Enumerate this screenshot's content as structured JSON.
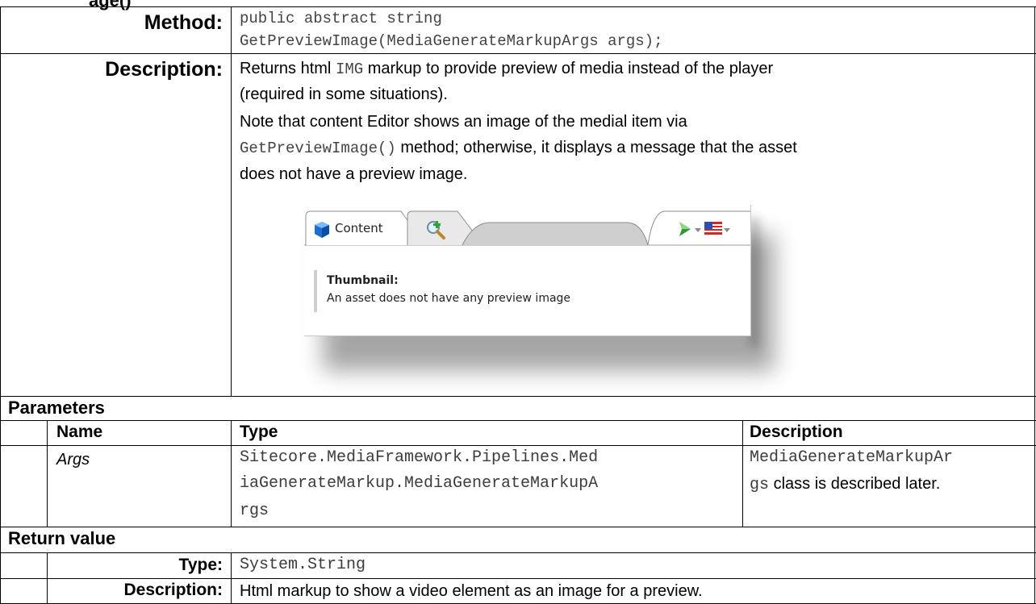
{
  "heading_fragment": "age()",
  "method": {
    "label": "Method:",
    "line1": "public abstract string",
    "line2": "GetPreviewImage(MediaGenerateMarkupArgs args);"
  },
  "description": {
    "label": "Description:",
    "line1_pre": "Returns html ",
    "line1_code": "IMG",
    "line1_post": " markup to provide preview of media instead of the player",
    "line2": "(required in some situations).",
    "line3": "Note that content Editor shows an image of the medial item via",
    "line4_code": "GetPreviewImage()",
    "line4_post": " method; otherwise, it displays a message that the asset",
    "line5": "does not have a preview image."
  },
  "screenshot": {
    "tab_content": "Content",
    "field_label": "Thumbnail:",
    "field_message": "An asset does not have any preview image",
    "icons": [
      "content-cube-icon",
      "search-add-icon",
      "navigate-arrow-icon",
      "flag-icon"
    ]
  },
  "parameters": {
    "title": "Parameters",
    "headers": [
      "Name",
      "Type",
      "Description"
    ],
    "row": {
      "name": "Args",
      "type_lines": [
        "Sitecore.MediaFramework.Pipelines.Med",
        "iaGenerateMarkup.MediaGenerateMarkupA",
        "rgs"
      ],
      "desc_line1": "MediaGenerateMarkupAr",
      "desc_line2_code": "gs",
      "desc_line2_post": " class is described later."
    }
  },
  "return_value": {
    "title": "Return value",
    "type_label": "Type:",
    "type_value": "System.String",
    "desc_label": "Description:",
    "desc_value": "Html markup to show a video element as an image for a preview."
  }
}
